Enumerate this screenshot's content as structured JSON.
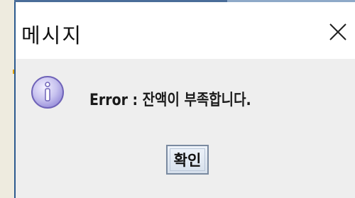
{
  "dialog": {
    "title": "메시지",
    "close_symbol": "✕",
    "icon": "info-icon",
    "message": "Error : 잔액이 부족합니다.",
    "ok_label": "확인"
  },
  "colors": {
    "dialog_border": "#2c5b8f",
    "content_bg": "#eeeeee",
    "icon_fill": "#c8c3ef",
    "icon_stroke": "#6f63b8"
  }
}
